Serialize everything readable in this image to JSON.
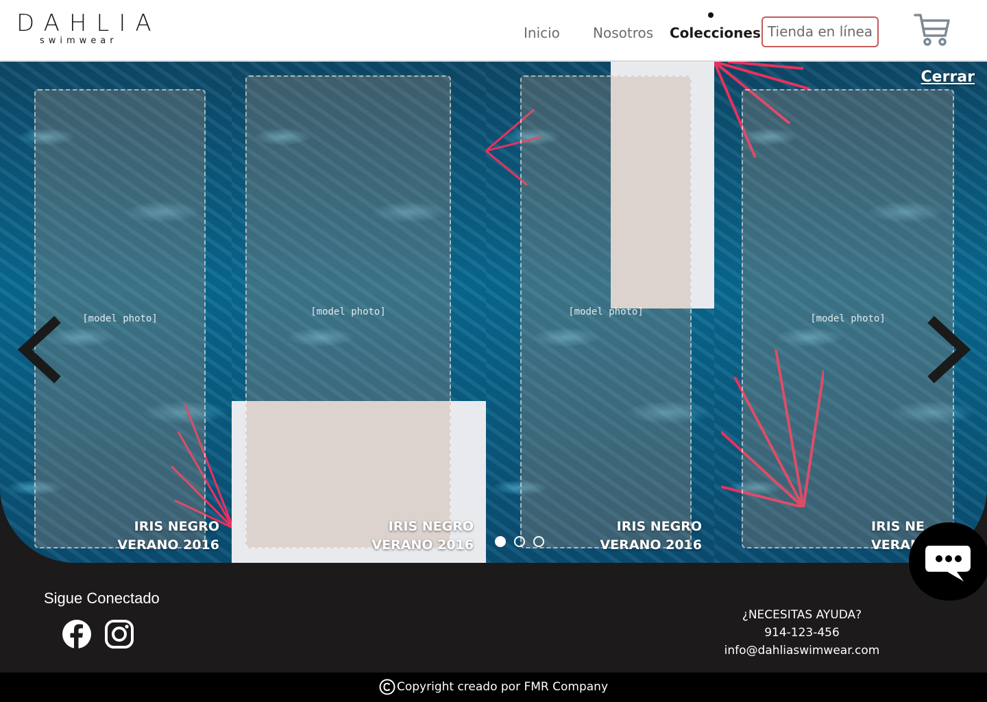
{
  "brand": {
    "name": "DAHLIA",
    "tagline": "swimwear"
  },
  "nav": {
    "items": [
      {
        "label": "Inicio"
      },
      {
        "label": "Nosotros"
      },
      {
        "label": "Colecciones"
      },
      {
        "label": "Tienda en línea"
      }
    ],
    "active": "Colecciones",
    "cart_icon": "shopping-cart-icon"
  },
  "gallery": {
    "close_label": "Cerrar",
    "slides": [
      {
        "caption_line1": "IRIS NEGRO",
        "caption_line2": "VERANO 2016"
      },
      {
        "caption_line1": "IRIS NEGRO",
        "caption_line2": "VERANO 2016"
      },
      {
        "caption_line1": "IRIS NEGRO",
        "caption_line2": "VERANO 2016"
      },
      {
        "caption_line1": "IRIS NE",
        "caption_line2": "VERAN"
      }
    ],
    "pagination": {
      "count": 3,
      "active_index": 0
    },
    "prev_icon": "chevron-left-icon",
    "next_icon": "chevron-right-icon"
  },
  "footer": {
    "follow_title": "Sigue Conectado",
    "social": [
      "facebook-icon",
      "instagram-icon"
    ],
    "help_title": "¿NECESITAS AYUDA?",
    "phone": "914-123-456",
    "email": "info@dahliaswimwear.com",
    "copyright": "Copyright creado por FMR Company"
  },
  "colors": {
    "header_bg": "#ffffff",
    "accent_border": "#c45a5a",
    "footer_bg": "#1c1a1a",
    "copyright_bg": "#000000"
  }
}
